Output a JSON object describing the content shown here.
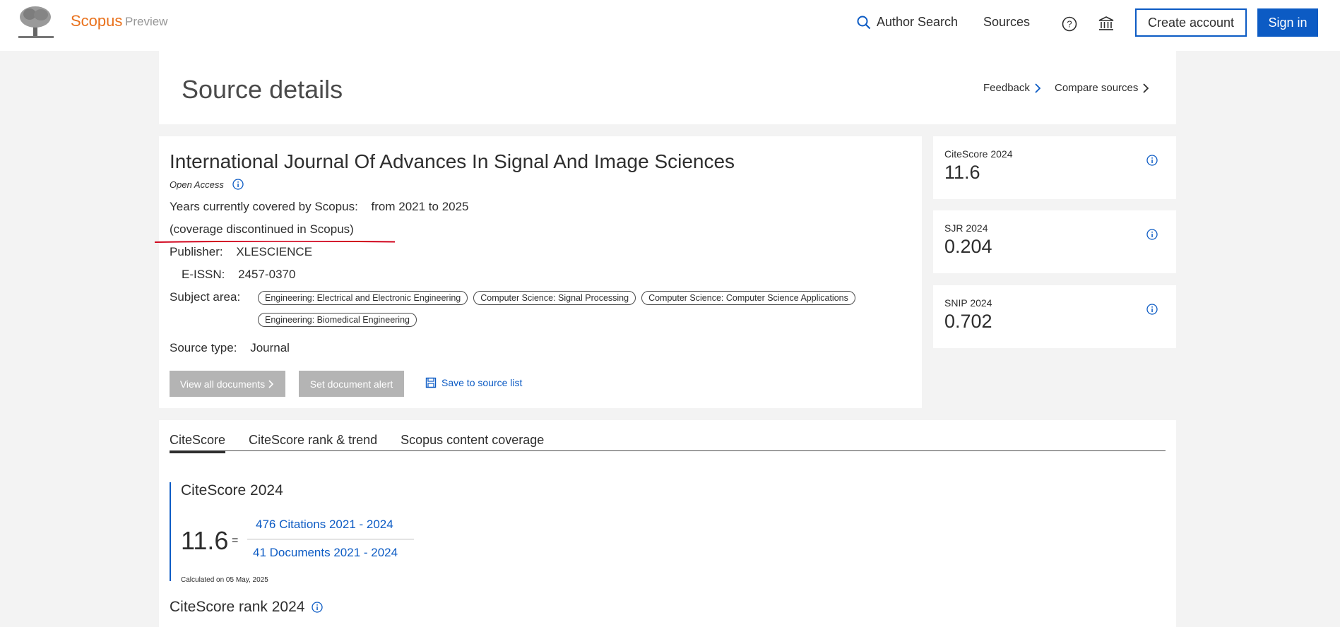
{
  "header": {
    "brand": "Scopus",
    "brand_sub": "Preview",
    "nav_author_search": "Author Search",
    "nav_sources": "Sources",
    "create_account": "Create account",
    "sign_in": "Sign in"
  },
  "title_panel": {
    "title": "Source details",
    "feedback": "Feedback",
    "compare_sources": "Compare sources"
  },
  "source": {
    "title": "International Journal Of Advances In Signal And Image Sciences",
    "open_access": "Open Access",
    "years_label": "Years currently covered by Scopus:",
    "years_value": "from 2021 to 2025",
    "coverage_note": "(coverage discontinued in Scopus)",
    "publisher_label": "Publisher:",
    "publisher_value": "XLESCIENCE",
    "eissn_label": "E-ISSN:",
    "eissn_value": "2457-0370",
    "subject_label": "Subject area:",
    "subjects": [
      "Engineering: Electrical and Electronic Engineering",
      "Computer Science: Signal Processing",
      "Computer Science: Computer Science Applications",
      "Engineering: Biomedical Engineering"
    ],
    "source_type_label": "Source type:",
    "source_type_value": "Journal",
    "view_all_documents": "View all documents",
    "set_document_alert": "Set document alert",
    "save_to_source_list": "Save to source list"
  },
  "metrics": [
    {
      "label": "CiteScore 2024",
      "value": "11.6"
    },
    {
      "label": "SJR 2024",
      "value": "0.204"
    },
    {
      "label": "SNIP 2024",
      "value": "0.702"
    }
  ],
  "tabs": [
    "CiteScore",
    "CiteScore rank & trend",
    "Scopus content coverage"
  ],
  "citescore": {
    "title": "CiteScore 2024",
    "value": "11.6",
    "equals": "=",
    "numerator": "476 Citations 2021 - 2024",
    "denominator": "41 Documents 2021 - 2024",
    "calculated": "Calculated on 05 May, 2025"
  },
  "rank": {
    "title": "CiteScore rank 2024"
  },
  "colors": {
    "accent": "#0c5bc4",
    "brand": "#e9711c",
    "annotation": "#d0021b"
  }
}
